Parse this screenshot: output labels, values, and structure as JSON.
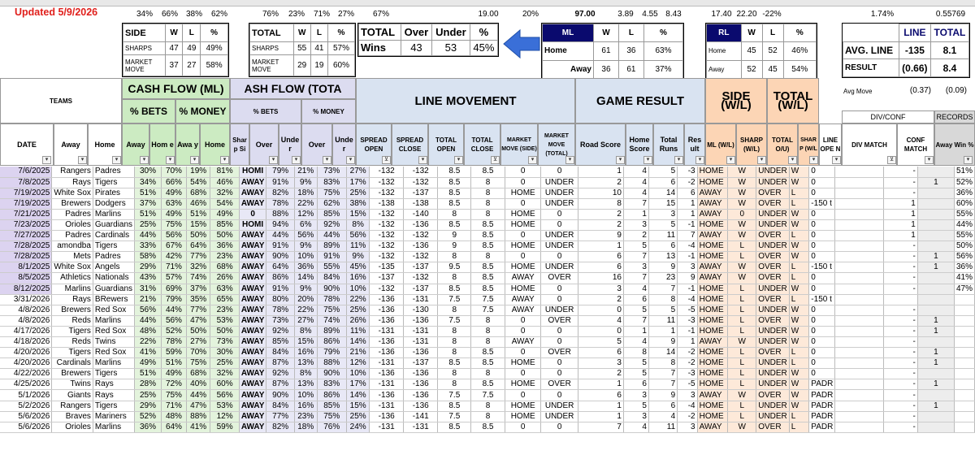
{
  "updated": "Updated 5/9/2026",
  "top_stats": {
    "s1": "34%",
    "s2": "66%",
    "s3": "38%",
    "s4": "62%",
    "s5": "76%",
    "s6": "23%",
    "s7": "71%",
    "s8": "27%",
    "s9": "67%",
    "s10": "19.00",
    "s11": "20%",
    "s12": "97.00",
    "s13": "3.89",
    "s14": "4.55",
    "s15": "8.43",
    "s16": "17.40",
    "s17": "22.20",
    "s18": "-22%",
    "s19": "1.74%",
    "s20": "0.55769"
  },
  "side_box": {
    "h1": "SIDE",
    "h2": "W",
    "h3": "L",
    "h4": "%",
    "r1c1": "SHARPS",
    "r1c2": "47",
    "r1c3": "49",
    "r1c4": "49%",
    "r2c1a": "MARKET",
    "r2c1b": "MOVE",
    "r2c2": "37",
    "r2c3": "27",
    "r2c4": "58%"
  },
  "total_box": {
    "h1": "TOTAL",
    "h2": "W",
    "h3": "L",
    "h4": "%",
    "r1c1": "SHARPS",
    "r1c2": "55",
    "r1c3": "41",
    "r1c4": "57%",
    "r2c1a": "MARKET",
    "r2c1b": "MOVE",
    "r2c2": "29",
    "r2c3": "19",
    "r2c4": "60%"
  },
  "total_wins": {
    "h1": "TOTAL",
    "h2": "Over",
    "h3": "Under",
    "h4": "%",
    "r1": "Wins",
    "v1": "43",
    "v2": "53",
    "v3": "45%"
  },
  "ml_box": {
    "h1": "ML",
    "h2": "W",
    "h3": "L",
    "h4": "%",
    "r1": "Home",
    "r1a": "61",
    "r1b": "36",
    "r1c": "63%",
    "r2": "Away",
    "r2a": "36",
    "r2b": "61",
    "r2c": "37%"
  },
  "rl_box": {
    "h1": "RL",
    "h2": "W",
    "h3": "L",
    "h4": "%",
    "r1": "Home",
    "r1a": "45",
    "r1b": "52",
    "r1c": "46%",
    "r2": "Away",
    "r2a": "52",
    "r2b": "45",
    "r2c": "54%"
  },
  "avg_box": {
    "h1": "LINE",
    "h2": "TOTAL",
    "r1": "AVG. LINE",
    "r1a": "-135",
    "r1b": "8.1",
    "r2": "RESULT",
    "r2a": "(0.66)",
    "r2b": "8.4"
  },
  "avg_move": {
    "label": "Avg Move",
    "v1": "(0.37)",
    "v2": "(0.09)"
  },
  "headers": {
    "teams": "TEAMS",
    "cash_ml": "CASH FLOW (ML)",
    "cash_total": "ASH FLOW (TOTA",
    "bets1": "% BETS",
    "money1": "% MONEY",
    "bets2": "% BETS",
    "money2": "% MONEY",
    "line_movement": "LINE MOVEMENT",
    "game_result": "GAME RESULT",
    "side_wl": "SIDE (W/L)",
    "total_wl": "TOTAL (W/L)",
    "div_conf": "DIV/CONF",
    "records": "RECORDS",
    "date": "DATE",
    "away": "Away",
    "home": "Home",
    "away_b": "Away",
    "hom_e": "Hom e",
    "awa_y": "Awa y",
    "home_m": "Home",
    "shar": "Shar p Si",
    "over": "Over",
    "under": "Unde r",
    "over2": "Over",
    "under2": "Unde r",
    "spread_open": "SPREAD OPEN",
    "spread_close": "SPREAD CLOSE",
    "total_open": "TOTAL OPEN",
    "total_close": "TOTAL CLOSE",
    "mm_side": "MARKET MOVE (SIDE)",
    "mm_total": "MARKET MOVE (TOTAL)",
    "road_score": "Road Score",
    "home_score": "Home Score",
    "total_runs": "Total Runs",
    "res": "Res ult",
    "ml": "ML (W/L)",
    "sharp": "SHARP (W/L)",
    "total_ou": "TOTAL O/U)",
    "sharp2": "SHAR P (W/L",
    "line_ope": "LINE OPE N",
    "div_match": "DIV MATCH",
    "conf_match": "CONF MATCH",
    "away_win": "Away Win %"
  },
  "rows": [
    [
      "7/6/2025",
      "Rangers",
      "Padres",
      "30%",
      "70%",
      "19%",
      "81%",
      "HOMI",
      "79%",
      "21%",
      "73%",
      "27%",
      "-132",
      "-132",
      "8.5",
      "8.5",
      "0",
      "0",
      "1",
      "4",
      "5",
      "-3",
      "HOME",
      "W",
      "UNDER",
      "W",
      "0",
      "",
      "-",
      "",
      "51%"
    ],
    [
      "7/8/2025",
      "Rays",
      "Tigers",
      "34%",
      "66%",
      "54%",
      "46%",
      "AWAY",
      "91%",
      "9%",
      "83%",
      "17%",
      "-132",
      "-132",
      "8.5",
      "8",
      "0",
      "UNDER",
      "2",
      "4",
      "6",
      "-2",
      "HOME",
      "W",
      "UNDER",
      "W",
      "0",
      "",
      "-",
      "1",
      "52%"
    ],
    [
      "7/19/2025",
      "White Sox",
      "Pirates",
      "51%",
      "49%",
      "68%",
      "32%",
      "AWAY",
      "82%",
      "18%",
      "75%",
      "25%",
      "-132",
      "-137",
      "8.5",
      "8",
      "HOME",
      "UNDER",
      "10",
      "4",
      "14",
      "6",
      "AWAY",
      "W",
      "OVER",
      "L",
      "0",
      "",
      "-",
      "",
      "36%"
    ],
    [
      "7/19/2025",
      "Brewers",
      "Dodgers",
      "37%",
      "63%",
      "46%",
      "54%",
      "AWAY",
      "78%",
      "22%",
      "62%",
      "38%",
      "-138",
      "-138",
      "8.5",
      "8",
      "0",
      "UNDER",
      "8",
      "7",
      "15",
      "1",
      "AWAY",
      "W",
      "OVER",
      "L",
      "-150 t",
      "",
      "1",
      "",
      "60%"
    ],
    [
      "7/21/2025",
      "Padres",
      "Marlins",
      "51%",
      "49%",
      "51%",
      "49%",
      "0",
      "88%",
      "12%",
      "85%",
      "15%",
      "-132",
      "-140",
      "8",
      "8",
      "HOME",
      "0",
      "2",
      "1",
      "3",
      "1",
      "AWAY",
      "0",
      "UNDER",
      "W",
      "0",
      "",
      "1",
      "",
      "55%"
    ],
    [
      "7/23/2025",
      "Orioles",
      "Guardians",
      "25%",
      "75%",
      "15%",
      "85%",
      "HOMI",
      "94%",
      "6%",
      "92%",
      "8%",
      "-132",
      "-136",
      "8.5",
      "8.5",
      "HOME",
      "0",
      "2",
      "3",
      "5",
      "-1",
      "HOME",
      "W",
      "UNDER",
      "W",
      "0",
      "",
      "1",
      "",
      "44%"
    ],
    [
      "7/27/2025",
      "Padres",
      "Cardinals",
      "44%",
      "56%",
      "50%",
      "50%",
      "AWAY",
      "44%",
      "56%",
      "44%",
      "56%",
      "-132",
      "-132",
      "9",
      "8.5",
      "0",
      "UNDER",
      "9",
      "2",
      "11",
      "7",
      "AWAY",
      "W",
      "OVER",
      "L",
      "0",
      "",
      "1",
      "",
      "55%"
    ],
    [
      "7/28/2025",
      "amondba",
      "Tigers",
      "33%",
      "67%",
      "64%",
      "36%",
      "AWAY",
      "91%",
      "9%",
      "89%",
      "11%",
      "-132",
      "-136",
      "9",
      "8.5",
      "HOME",
      "UNDER",
      "1",
      "5",
      "6",
      "-4",
      "HOME",
      "L",
      "UNDER",
      "W",
      "0",
      "",
      "-",
      "",
      "50%"
    ],
    [
      "7/28/2025",
      "Mets",
      "Padres",
      "58%",
      "42%",
      "77%",
      "23%",
      "AWAY",
      "90%",
      "10%",
      "91%",
      "9%",
      "-132",
      "-132",
      "8",
      "8",
      "0",
      "0",
      "6",
      "7",
      "13",
      "-1",
      "HOME",
      "L",
      "OVER",
      "W",
      "0",
      "",
      "-",
      "1",
      "56%"
    ],
    [
      "8/1/2025",
      "White Sox",
      "Angels",
      "29%",
      "71%",
      "32%",
      "68%",
      "AWAY",
      "64%",
      "36%",
      "55%",
      "45%",
      "-135",
      "-137",
      "9.5",
      "8.5",
      "HOME",
      "UNDER",
      "6",
      "3",
      "9",
      "3",
      "AWAY",
      "W",
      "OVER",
      "L",
      "-150 t",
      "",
      "-",
      "1",
      "36%"
    ],
    [
      "8/5/2025",
      "Athletics",
      "Nationals",
      "43%",
      "57%",
      "74%",
      "26%",
      "AWAY",
      "86%",
      "14%",
      "84%",
      "16%",
      "-137",
      "-132",
      "8",
      "8.5",
      "AWAY",
      "OVER",
      "16",
      "7",
      "23",
      "9",
      "AWAY",
      "W",
      "OVER",
      "L",
      "0",
      "",
      "-",
      "",
      "41%"
    ],
    [
      "8/12/2025",
      "Marlins",
      "Guardians",
      "31%",
      "69%",
      "37%",
      "63%",
      "AWAY",
      "91%",
      "9%",
      "90%",
      "10%",
      "-132",
      "-137",
      "8.5",
      "8.5",
      "HOME",
      "0",
      "3",
      "4",
      "7",
      "-1",
      "HOME",
      "L",
      "UNDER",
      "W",
      "0",
      "",
      "-",
      "",
      "47%"
    ],
    [
      "3/31/2026",
      "Rays",
      "BRewers",
      "21%",
      "79%",
      "35%",
      "65%",
      "AWAY",
      "80%",
      "20%",
      "78%",
      "22%",
      "-136",
      "-131",
      "7.5",
      "7.5",
      "AWAY",
      "0",
      "2",
      "6",
      "8",
      "-4",
      "HOME",
      "L",
      "OVER",
      "L",
      "-150 t",
      "",
      "",
      "",
      ""
    ],
    [
      "4/8/2026",
      "Brewers",
      "Red Sox",
      "56%",
      "44%",
      "77%",
      "23%",
      "AWAY",
      "78%",
      "22%",
      "75%",
      "25%",
      "-136",
      "-130",
      "8",
      "7.5",
      "AWAY",
      "UNDER",
      "0",
      "5",
      "5",
      "-5",
      "HOME",
      "L",
      "UNDER",
      "W",
      "0",
      "",
      "-",
      "",
      ""
    ],
    [
      "4/8/2026",
      "Reds",
      "Marlins",
      "44%",
      "56%",
      "47%",
      "53%",
      "AWAY",
      "73%",
      "27%",
      "74%",
      "26%",
      "-136",
      "-136",
      "7.5",
      "8",
      "0",
      "OVER",
      "4",
      "7",
      "11",
      "-3",
      "HOME",
      "L",
      "OVER",
      "W",
      "0",
      "",
      "-",
      "1",
      ""
    ],
    [
      "4/17/2026",
      "Tigers",
      "Red Sox",
      "48%",
      "52%",
      "50%",
      "50%",
      "AWAY",
      "92%",
      "8%",
      "89%",
      "11%",
      "-131",
      "-131",
      "8",
      "8",
      "0",
      "0",
      "0",
      "1",
      "1",
      "-1",
      "HOME",
      "L",
      "UNDER",
      "W",
      "0",
      "",
      "-",
      "1",
      ""
    ],
    [
      "4/18/2026",
      "Reds",
      "Twins",
      "22%",
      "78%",
      "27%",
      "73%",
      "AWAY",
      "85%",
      "15%",
      "86%",
      "14%",
      "-136",
      "-131",
      "8",
      "8",
      "AWAY",
      "0",
      "5",
      "4",
      "9",
      "1",
      "AWAY",
      "W",
      "UNDER",
      "W",
      "0",
      "",
      "-",
      "",
      ""
    ],
    [
      "4/20/2026",
      "Tigers",
      "Red Sox",
      "41%",
      "59%",
      "70%",
      "30%",
      "AWAY",
      "84%",
      "16%",
      "79%",
      "21%",
      "-136",
      "-136",
      "8",
      "8.5",
      "0",
      "OVER",
      "6",
      "8",
      "14",
      "-2",
      "HOME",
      "L",
      "OVER",
      "L",
      "0",
      "",
      "-",
      "1",
      ""
    ],
    [
      "4/20/2026",
      "Cardinals",
      "Marlins",
      "49%",
      "51%",
      "75%",
      "25%",
      "AWAY",
      "87%",
      "13%",
      "88%",
      "12%",
      "-131",
      "-137",
      "8.5",
      "8.5",
      "HOME",
      "0",
      "3",
      "5",
      "8",
      "-2",
      "HOME",
      "L",
      "UNDER",
      "L",
      "0",
      "",
      "-",
      "1",
      ""
    ],
    [
      "4/22/2026",
      "Brewers",
      "Tigers",
      "51%",
      "49%",
      "68%",
      "32%",
      "AWAY",
      "92%",
      "8%",
      "90%",
      "10%",
      "-136",
      "-136",
      "8",
      "8",
      "0",
      "0",
      "2",
      "5",
      "7",
      "-3",
      "HOME",
      "L",
      "UNDER",
      "W",
      "0",
      "",
      "-",
      "",
      ""
    ],
    [
      "4/25/2026",
      "Twins",
      "Rays",
      "28%",
      "72%",
      "40%",
      "60%",
      "AWAY",
      "87%",
      "13%",
      "83%",
      "17%",
      "-131",
      "-136",
      "8",
      "8.5",
      "HOME",
      "OVER",
      "1",
      "6",
      "7",
      "-5",
      "HOME",
      "L",
      "UNDER",
      "W",
      "PADR",
      "",
      "-",
      "1",
      ""
    ],
    [
      "5/1/2026",
      "Giants",
      "Rays",
      "25%",
      "75%",
      "44%",
      "56%",
      "AWAY",
      "90%",
      "10%",
      "86%",
      "14%",
      "-136",
      "-136",
      "7.5",
      "7.5",
      "0",
      "0",
      "6",
      "3",
      "9",
      "3",
      "AWAY",
      "W",
      "OVER",
      "W",
      "PADR",
      "",
      "-",
      "",
      ""
    ],
    [
      "5/2/2026",
      "Rangers",
      "Tigers",
      "29%",
      "71%",
      "47%",
      "53%",
      "AWAY",
      "84%",
      "16%",
      "85%",
      "15%",
      "-131",
      "-136",
      "8.5",
      "8",
      "HOME",
      "UNDER",
      "1",
      "5",
      "6",
      "-4",
      "HOME",
      "L",
      "UNDER",
      "W",
      "PADR",
      "",
      "-",
      "1",
      ""
    ],
    [
      "5/6/2026",
      "Braves",
      "Mariners",
      "52%",
      "48%",
      "88%",
      "12%",
      "AWAY",
      "77%",
      "23%",
      "75%",
      "25%",
      "-136",
      "-141",
      "7.5",
      "8",
      "HOME",
      "UNDER",
      "1",
      "3",
      "4",
      "-2",
      "HOME",
      "L",
      "UNDER",
      "L",
      "PADR",
      "",
      "-",
      "",
      ""
    ],
    [
      "5/6/2026",
      "Orioles",
      "Marlins",
      "36%",
      "64%",
      "41%",
      "59%",
      "AWAY",
      "82%",
      "18%",
      "76%",
      "24%",
      "-131",
      "-131",
      "8.5",
      "8.5",
      "0",
      "0",
      "7",
      "4",
      "11",
      "3",
      "AWAY",
      "W",
      "OVER",
      "L",
      "PADR",
      "",
      "-",
      "",
      ""
    ]
  ]
}
